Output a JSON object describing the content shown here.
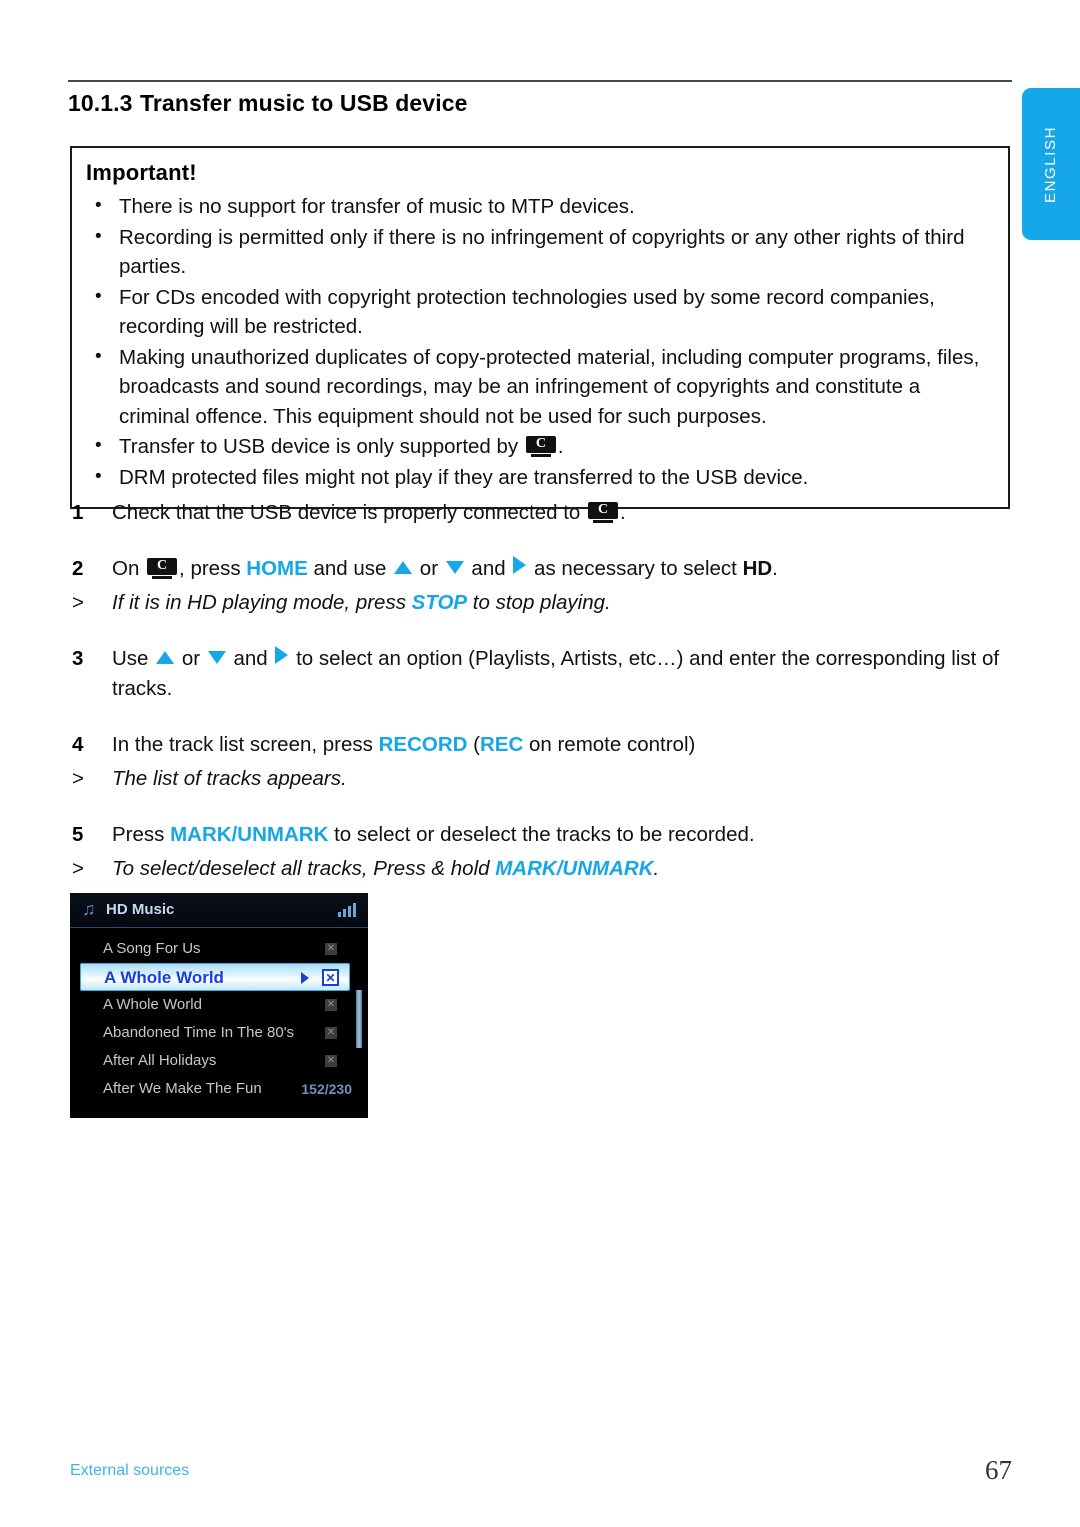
{
  "language_tab": {
    "label": "ENGLISH"
  },
  "heading": {
    "number": "10.1.3",
    "title": "Transfer music to USB device"
  },
  "important_box": {
    "title": "Important!",
    "bullets": [
      {
        "before": "There is no support for transfer of music to MTP devices.",
        "icon": null,
        "after": null
      },
      {
        "before": "Recording is permitted only if there is no infringement of copyrights or any other rights of third parties.",
        "icon": null,
        "after": null
      },
      {
        "before": "For CDs encoded with copyright protection technologies used by some record companies, recording will be restricted.",
        "icon": null,
        "after": null
      },
      {
        "before": "Making unauthorized duplicates of copy-protected material, including computer programs, files, broadcasts and sound recordings, may be an infringement of copyrights and constitute a criminal offence. This equipment should not be used for such purposes.",
        "icon": null,
        "after": null
      },
      {
        "before": "Transfer to USB device is only supported by ",
        "icon": "center-device-icon",
        "after": "."
      },
      {
        "before": "DRM protected files might not play if they are transferred to the USB device.",
        "icon": null,
        "after": null
      }
    ]
  },
  "steps": {
    "step1": {
      "num": "1",
      "text_before": "Check that the USB device is properly connected to ",
      "icon": "center-device-icon",
      "text_after": "."
    },
    "step2": {
      "num": "2",
      "t1": "On ",
      "icon": "center-device-icon",
      "t2": ", press ",
      "k1": "HOME",
      "t3": " and use ",
      "arrow_up": "up-triangle-icon",
      "t4": " or ",
      "arrow_down": "down-triangle-icon",
      "t5": " and ",
      "arrow_right": "right-triangle-icon",
      "t6": " as necessary to select ",
      "k2": "HD",
      "t7": "."
    },
    "note2": {
      "marker": ">",
      "t1": "If it is in HD playing mode, press ",
      "k1": "STOP",
      "t2": " to stop playing."
    },
    "step3": {
      "num": "3",
      "t1": "Use ",
      "arrow_up": "up-triangle-icon",
      "t2": " or ",
      "arrow_down": "down-triangle-icon",
      "t3": " and ",
      "arrow_right": "right-triangle-icon",
      "t4": " to select an option (Playlists, Artists, etc…) and enter the corresponding list of tracks."
    },
    "step4": {
      "num": "4",
      "t1": "In the track list screen, press ",
      "k1": "RECORD",
      "t2": " (",
      "k2": "REC",
      "t3": " on remote control)"
    },
    "note4": {
      "marker": ">",
      "t1": "The list of tracks appears."
    },
    "step5": {
      "num": "5",
      "t1": "Press ",
      "k1": "MARK/UNMARK",
      "t2": " to select or deselect the tracks to be recorded."
    },
    "note5": {
      "marker": ">",
      "t1": "To select/deselect all tracks, Press & hold ",
      "k1": "MARK/UNMARK",
      "t2": "."
    }
  },
  "device_screen": {
    "note_icon": "music-note-icon",
    "title": "HD Music",
    "signal_icon": "signal-strength-icon",
    "tracks": [
      {
        "name": "A Song For Us",
        "mark": "✕",
        "selected": false,
        "counter": null
      },
      {
        "name": "A Whole World",
        "mark": "✕",
        "selected": true,
        "counter": null
      },
      {
        "name": "A Whole World",
        "mark": "✕",
        "selected": false,
        "counter": null
      },
      {
        "name": "Abandoned Time In The 80's",
        "mark": "✕",
        "selected": false,
        "counter": null
      },
      {
        "name": "After All Holidays",
        "mark": "✕",
        "selected": false,
        "counter": null
      },
      {
        "name": "After We Make The Fun",
        "mark": null,
        "selected": false,
        "counter": "152/230"
      }
    ]
  },
  "footer": {
    "label": "External sources",
    "page": "67"
  },
  "colors": {
    "accent_blue": "#16a7e8",
    "footer_blue": "#3fb2ec",
    "selected_text_blue": "#1840d8",
    "device_bg": "#000000"
  }
}
